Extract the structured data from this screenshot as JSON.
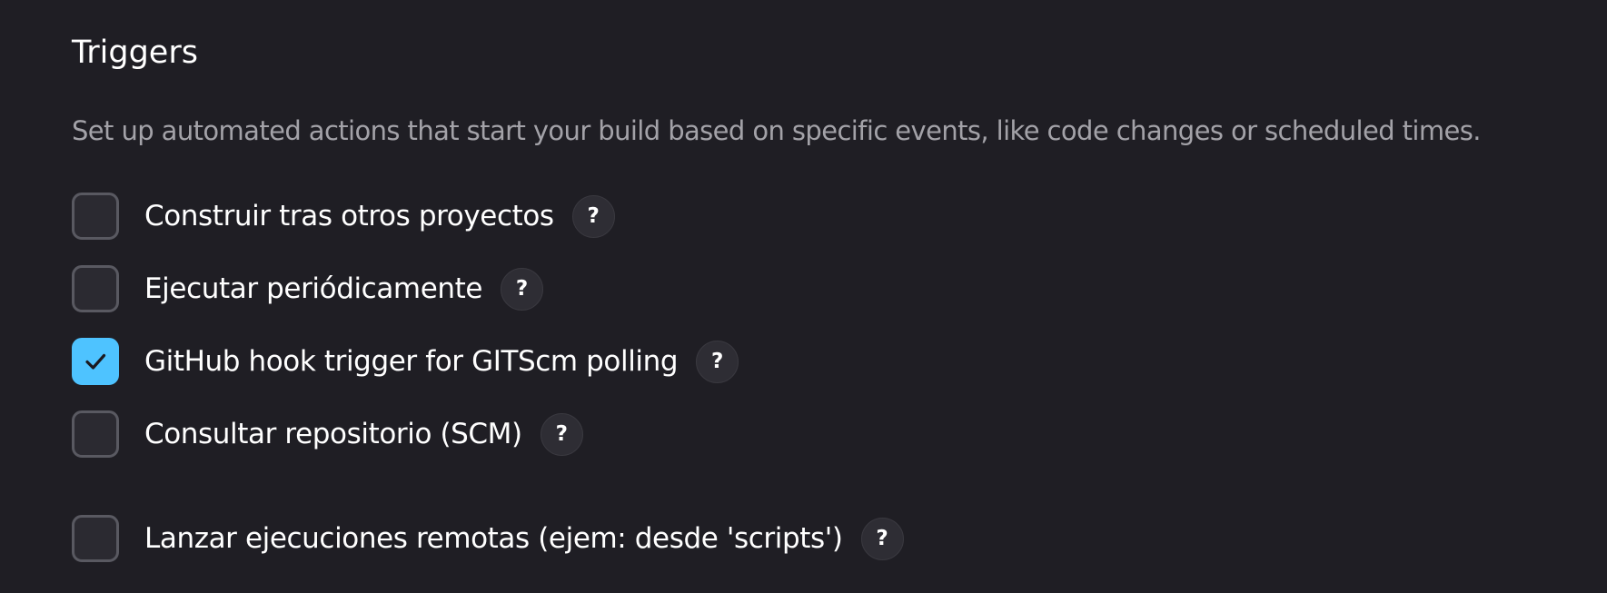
{
  "section": {
    "title": "Triggers",
    "description": "Set up automated actions that start your build based on specific events, like code changes or scheduled times."
  },
  "options": [
    {
      "label": "Construir tras otros proyectos",
      "checked": false,
      "help": "?"
    },
    {
      "label": "Ejecutar periódicamente",
      "checked": false,
      "help": "?"
    },
    {
      "label": "GitHub hook trigger for GITScm polling",
      "checked": true,
      "help": "?"
    },
    {
      "label": "Consultar repositorio (SCM)",
      "checked": false,
      "help": "?"
    },
    {
      "label": "Lanzar ejecuciones remotas (ejem: desde 'scripts')",
      "checked": false,
      "help": "?"
    }
  ],
  "colors": {
    "background": "#1f1e24",
    "accent_checked": "#4ec3ff",
    "checkbox_border": "#595961",
    "description_text": "#a3a2a8"
  },
  "icons": {
    "check": "check-icon",
    "help": "help-icon"
  }
}
